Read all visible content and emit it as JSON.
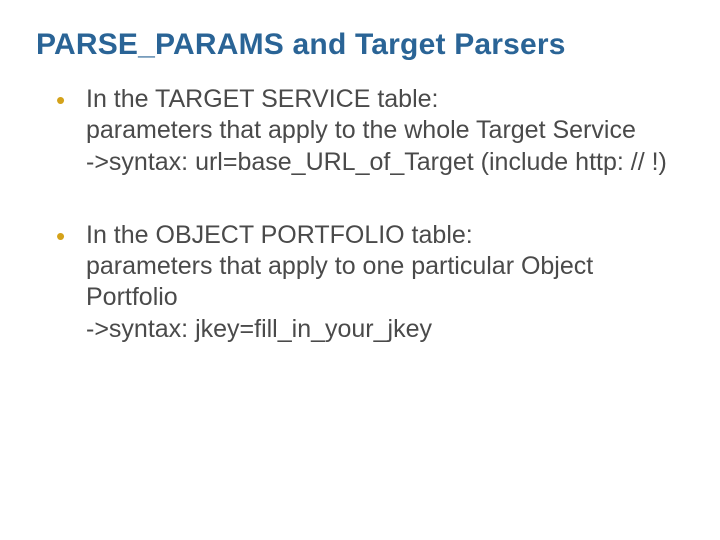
{
  "title": "PARSE_PARAMS and Target Parsers",
  "bullets": [
    {
      "head": "In the TARGET SERVICE table:",
      "desc": "parameters that apply to the whole Target Service",
      "syntax": "->syntax: url=base_URL_of_Target (include http: // !)"
    },
    {
      "head": "In the OBJECT PORTFOLIO table:",
      "desc": "parameters that apply to one particular Object Portfolio",
      "syntax": "->syntax: jkey=fill_in_your_jkey"
    }
  ]
}
